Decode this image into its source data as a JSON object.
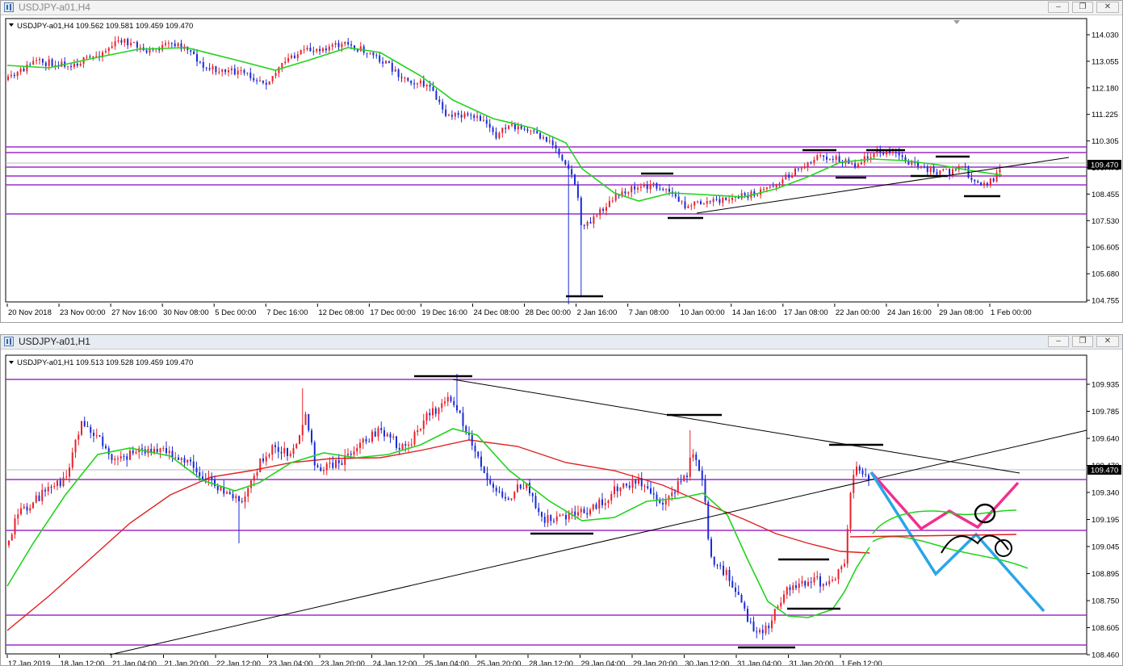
{
  "windows": [
    {
      "id": "h4",
      "title": "USDJPY-a01,H4",
      "info": "USDJPY-a01,H4  109.562 109.581 109.459 109.470",
      "current_price": "109.470",
      "price_ticks": [
        "114.030",
        "113.055",
        "112.180",
        "111.225",
        "110.305",
        "109.470",
        "108.455",
        "107.530",
        "106.605",
        "105.680",
        "104.755"
      ],
      "time_ticks": [
        "20 Nov 2018",
        "23 Nov 00:00",
        "27 Nov 16:00",
        "30 Nov 08:00",
        "5 Dec 00:00",
        "7 Dec 16:00",
        "12 Dec 08:00",
        "17 Dec 00:00",
        "19 Dec 16:00",
        "24 Dec 08:00",
        "28 Dec 00:00",
        "2 Jan 16:00",
        "7 Jan 08:00",
        "10 Jan 00:00",
        "14 Jan 16:00",
        "17 Jan 08:00",
        "22 Jan 00:00",
        "24 Jan 16:00",
        "29 Jan 08:00",
        "1 Feb 00:00"
      ],
      "colors": {
        "bull": "#e8222a",
        "bear": "#1a2bd6",
        "ma": "#22d31e",
        "level": "#9b2fc7"
      }
    },
    {
      "id": "h1",
      "title": "USDJPY-a01,H1",
      "info": "USDJPY-a01,H1  109.513 109.528 109.459 109.470",
      "current_price": "109.470",
      "price_ticks": [
        "109.935",
        "109.785",
        "109.640",
        "109.470",
        "109.340",
        "109.195",
        "109.045",
        "108.895",
        "108.750",
        "108.605",
        "108.460"
      ],
      "time_ticks": [
        "17 Jan 2019",
        "18 Jan 12:00",
        "21 Jan 04:00",
        "21 Jan 20:00",
        "22 Jan 12:00",
        "23 Jan 04:00",
        "23 Jan 20:00",
        "24 Jan 12:00",
        "25 Jan 04:00",
        "25 Jan 20:00",
        "28 Jan 12:00",
        "29 Jan 04:00",
        "29 Jan 20:00",
        "30 Jan 12:00",
        "31 Jan 04:00",
        "31 Jan 20:00",
        "1 Feb 12:00"
      ],
      "colors": {
        "bull": "#e8222a",
        "bear": "#1a2bd6",
        "ma_fast": "#22d31e",
        "ma_slow": "#e02020",
        "level": "#9b2fc7",
        "proj_up": "#f0308f",
        "proj_down": "#2aa5e8"
      }
    }
  ],
  "icons": {
    "window": "chart-window-icon",
    "minimize": "minimize-icon",
    "restore": "restore-icon",
    "close": "close-icon"
  }
}
